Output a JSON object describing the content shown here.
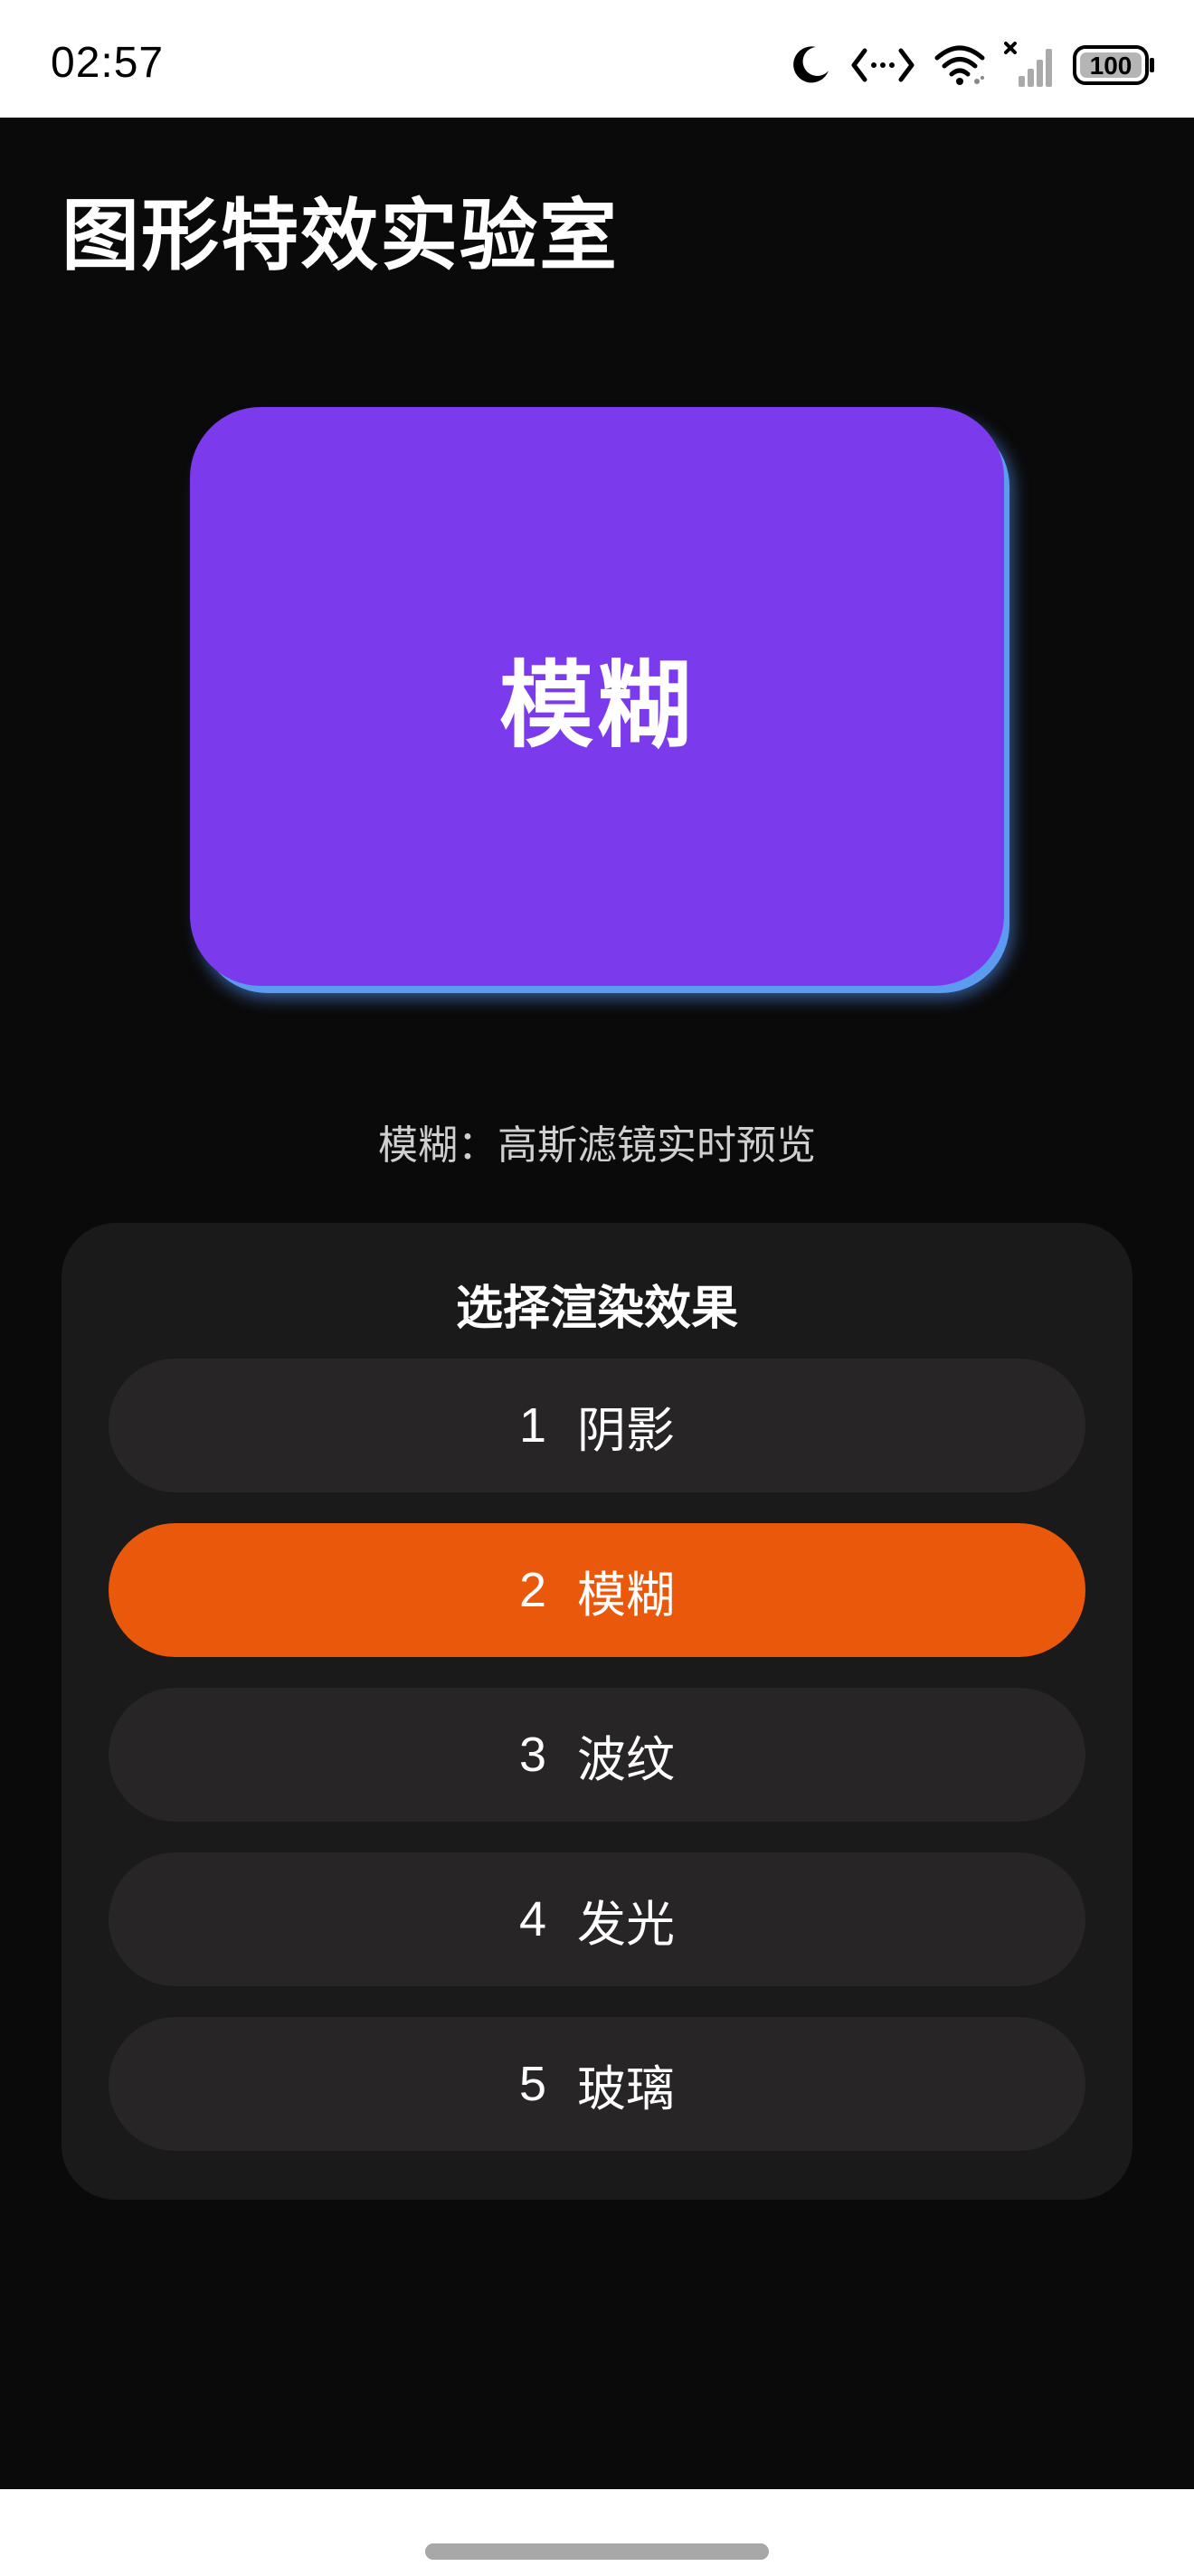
{
  "status_bar": {
    "time": "02:57",
    "battery": "100",
    "icons": [
      "moon-icon",
      "code-arrows-icon",
      "wifi-icon",
      "signal-icon",
      "battery-icon"
    ]
  },
  "page": {
    "title": "图形特效实验室"
  },
  "preview": {
    "label": "模糊",
    "color": "#7c3aed",
    "shadow_color": "#5b9cf0"
  },
  "description": "模糊：高斯滤镜实时预览",
  "selector": {
    "title": "选择渲染效果",
    "options": [
      {
        "num": "1",
        "label": "阴影",
        "selected": false
      },
      {
        "num": "2",
        "label": "模糊",
        "selected": true
      },
      {
        "num": "3",
        "label": "波纹",
        "selected": false
      },
      {
        "num": "4",
        "label": "发光",
        "selected": false
      },
      {
        "num": "5",
        "label": "玻璃",
        "selected": false
      }
    ],
    "selected_color": "#ea580c",
    "option_color": "#272525"
  }
}
